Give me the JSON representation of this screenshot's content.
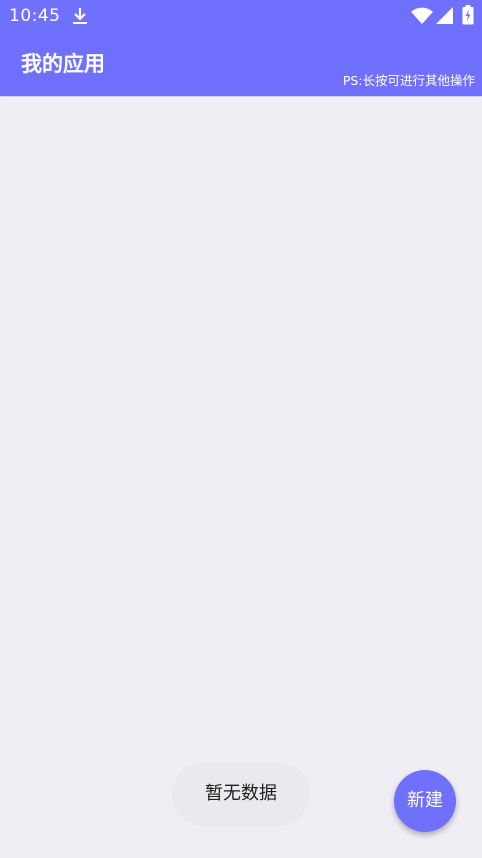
{
  "status_bar": {
    "time": "10:45",
    "icons": [
      "download-icon",
      "wifi-icon",
      "signal-icon",
      "battery-charging-icon"
    ]
  },
  "app_bar": {
    "title": "我的应用",
    "hint": "PS:长按可进行其他操作"
  },
  "empty_state": {
    "message": "暂无数据"
  },
  "fab": {
    "label": "新建"
  },
  "colors": {
    "primary": "#7070ff",
    "background": "#efeef4",
    "toast_background": "#e9e9ee"
  }
}
